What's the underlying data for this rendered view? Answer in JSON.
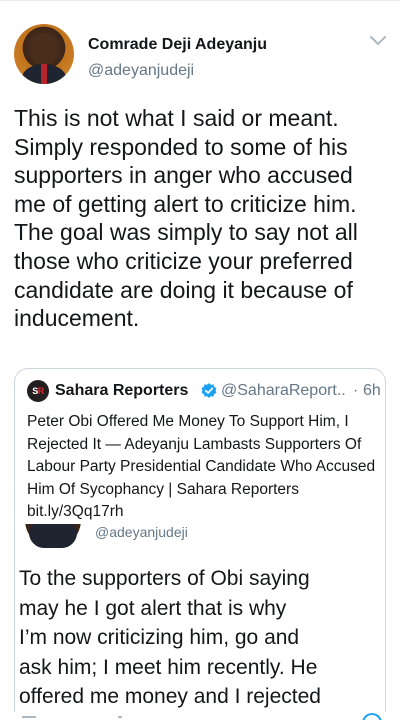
{
  "tweet": {
    "display_name": "Comrade Deji Adeyanju",
    "handle": "@adeyanjudeji",
    "text": "This is not what I said or meant.\nSimply responded to some of his\nsupporters in anger who accused\nme of getting alert to criticize him.\nThe goal was simply to say not all\nthose who criticize your preferred\ncandidate are doing it because of\ninducement.",
    "avatar_icon": "user-avatar",
    "menu_icon": "chevron-down-icon"
  },
  "quote": {
    "logo_text_a": "S",
    "logo_text_b": "R",
    "name": "Sahara Reporters",
    "verified_icon": "verified-badge-icon",
    "handle": "@SaharaReport...",
    "dot": "·",
    "time": "6h",
    "text": "Peter Obi Offered Me Money To Support Him, I Rejected It — Adeyanju Lambasts Supporters Of Labour Party Presidential Candidate Who Accused Him Of Sycophancy | Sahara Reporters bit.ly/3Qq17rh"
  },
  "embedded_image": {
    "handle": "@adeyanjudeji",
    "text": "To the supporters of Obi saying\nmay he I got alert that is why\nI’m now criticizing him, go and\nask him; I meet him recently. He\noffered me money and I rejected"
  },
  "colors": {
    "text": "#14171a",
    "secondary": "#657786",
    "border": "#ccd6dd",
    "verified": "#1da1f2"
  }
}
